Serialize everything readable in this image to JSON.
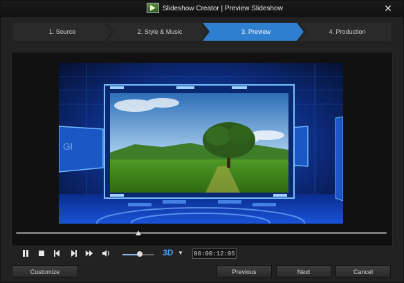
{
  "window": {
    "title": "Slideshow Creator | Preview Slideshow"
  },
  "steps": [
    {
      "label": "1. Source",
      "active": false
    },
    {
      "label": "2. Style & Music",
      "active": false
    },
    {
      "label": "3. Preview",
      "active": true
    },
    {
      "label": "4. Production",
      "active": false
    }
  ],
  "player": {
    "timecode": "00:00:12:05",
    "mode_badge": "3D",
    "playback_position": 0.33,
    "volume_level": 0.55
  },
  "buttons": {
    "customize": "Customize",
    "previous": "Previous",
    "next": "Next",
    "cancel": "Cancel"
  },
  "colors": {
    "active_step": "#2f7fd0",
    "accent_3d": "#4aa3ff"
  }
}
